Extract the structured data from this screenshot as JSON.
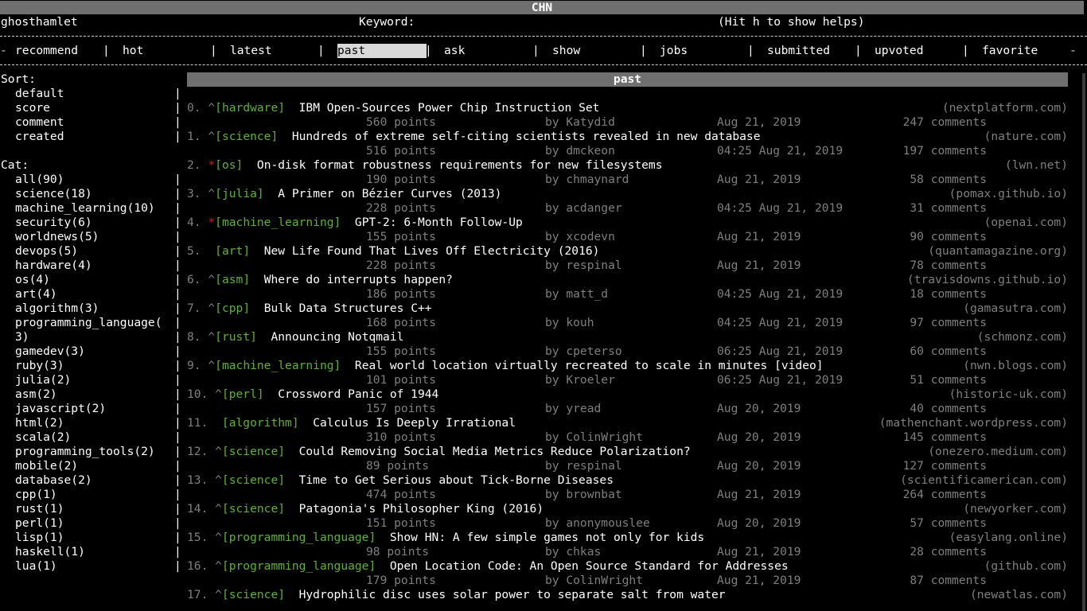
{
  "app": {
    "title": "CHN"
  },
  "header": {
    "user": "ghosthamlet",
    "keyword_label": "Keyword:",
    "help_hint": "(Hit h to show helps)"
  },
  "tabs": [
    {
      "label": "recommend"
    },
    {
      "label": "hot"
    },
    {
      "label": "latest"
    },
    {
      "label": "past",
      "selected": true
    },
    {
      "label": "ask"
    },
    {
      "label": "show"
    },
    {
      "label": "jobs"
    },
    {
      "label": "submitted"
    },
    {
      "label": "upvoted"
    },
    {
      "label": "favorite"
    }
  ],
  "sidebar": {
    "sort_label": "Sort:",
    "sort_items": [
      "default",
      "score",
      "comment",
      "created"
    ],
    "cat_label": "Cat:",
    "cat_items": [
      "all(90)",
      "science(18)",
      "machine_learning(10)",
      "security(6)",
      "worldnews(5)",
      "devops(5)",
      "hardware(4)",
      "os(4)",
      "art(4)",
      "algorithm(3)",
      "programming_language(",
      "3)",
      "gamedev(3)",
      "ruby(3)",
      "julia(2)",
      "asm(2)",
      "javascript(2)",
      "html(2)",
      "scala(2)",
      "programming_tools(2)",
      "mobile(2)",
      "database(2)",
      "cpp(1)",
      "rust(1)",
      "perl(1)",
      "lisp(1)",
      "haskell(1)",
      "lua(1)"
    ]
  },
  "main": {
    "section_title": "past",
    "stories": [
      {
        "n": "0.",
        "mark": "^",
        "cat": "[hardware]",
        "title": "IBM Open-Sources Power Chip Instruction Set",
        "site": "(nextplatform.com)",
        "points": "560 points",
        "by": "by Katydid",
        "date": "Aug 21, 2019",
        "comments": "247 comments"
      },
      {
        "n": "1.",
        "mark": "^",
        "cat": "[science]",
        "title": "Hundreds of extreme self-citing scientists revealed in new database",
        "site": "(nature.com)",
        "points": "516 points",
        "by": "by dmckeon",
        "date": "04:25 Aug 21, 2019",
        "comments": "197 comments"
      },
      {
        "n": "2.",
        "mark": "*",
        "cat": "[os]",
        "title": "On-disk format robustness requirements for new filesystems",
        "site": "(lwn.net)",
        "points": "190 points",
        "by": "by chmaynard",
        "date": "Aug 21, 2019",
        "comments": "58 comments"
      },
      {
        "n": "3.",
        "mark": "^",
        "cat": "[julia]",
        "title": "A Primer on Bézier Curves (2013)",
        "site": "(pomax.github.io)",
        "points": "228 points",
        "by": "by acdanger",
        "date": "04:25 Aug 21, 2019",
        "comments": "31 comments"
      },
      {
        "n": "4.",
        "mark": "*",
        "cat": "[machine_learning]",
        "title": "GPT-2: 6-Month Follow-Up",
        "site": "(openai.com)",
        "points": "155 points",
        "by": "by xcodevn",
        "date": "Aug 21, 2019",
        "comments": "90 comments"
      },
      {
        "n": "5.",
        "mark": "",
        "cat": "[art]",
        "title": "New Life Found That Lives Off Electricity (2016)",
        "site": "(quantamagazine.org)",
        "points": "228 points",
        "by": "by respinal",
        "date": "Aug 21, 2019",
        "comments": "78 comments"
      },
      {
        "n": "6.",
        "mark": "^",
        "cat": "[asm]",
        "title": "Where do interrupts happen?",
        "site": "(travisdowns.github.io)",
        "points": "186 points",
        "by": "by matt_d",
        "date": "04:25 Aug 21, 2019",
        "comments": "18 comments"
      },
      {
        "n": "7.",
        "mark": "^",
        "cat": "[cpp]",
        "title": "Bulk Data Structures C++",
        "site": "(gamasutra.com)",
        "points": "168 points",
        "by": "by kouh",
        "date": "04:25 Aug 21, 2019",
        "comments": "97 comments"
      },
      {
        "n": "8.",
        "mark": "^",
        "cat": "[rust]",
        "title": "Announcing Notqmail",
        "site": "(schmonz.com)",
        "points": "155 points",
        "by": "by cpeterso",
        "date": "06:25 Aug 21, 2019",
        "comments": "60 comments"
      },
      {
        "n": "9.",
        "mark": "^",
        "cat": "[machine_learning]",
        "title": "Real world location virtually recreated to scale in minutes [video]",
        "site": "(nwn.blogs.com)",
        "points": "101 points",
        "by": "by Kroeler",
        "date": "06:25 Aug 21, 2019",
        "comments": "51 comments"
      },
      {
        "n": "10.",
        "mark": "^",
        "cat": "[perl]",
        "title": "Crossword Panic of 1944",
        "site": "(historic-uk.com)",
        "points": "157 points",
        "by": "by yread",
        "date": "Aug 20, 2019",
        "comments": "40 comments"
      },
      {
        "n": "11.",
        "mark": "",
        "cat": "[algorithm]",
        "title": "Calculus Is Deeply Irrational",
        "site": "(mathenchant.wordpress.com)",
        "points": "310 points",
        "by": "by ColinWright",
        "date": "Aug 20, 2019",
        "comments": "145 comments"
      },
      {
        "n": "12.",
        "mark": "^",
        "cat": "[science]",
        "title": "Could Removing Social Media Metrics Reduce Polarization?",
        "site": "(onezero.medium.com)",
        "points": "89 points",
        "by": "by respinal",
        "date": "Aug 20, 2019",
        "comments": "127 comments"
      },
      {
        "n": "13.",
        "mark": "^",
        "cat": "[science]",
        "title": "Time to Get Serious about Tick-Borne Diseases",
        "site": "(scientificamerican.com)",
        "points": "474 points",
        "by": "by brownbat",
        "date": "Aug 21, 2019",
        "comments": "264 comments"
      },
      {
        "n": "14.",
        "mark": "^",
        "cat": "[science]",
        "title": "Patagonia's Philosopher King (2016)",
        "site": "(newyorker.com)",
        "points": "151 points",
        "by": "by anonymouslee",
        "date": "Aug 20, 2019",
        "comments": "57 comments"
      },
      {
        "n": "15.",
        "mark": "^",
        "cat": "[programming_language]",
        "title": "Show HN: A few simple games not only for kids",
        "site": "(easylang.online)",
        "points": "98 points",
        "by": "by chkas",
        "date": "Aug 21, 2019",
        "comments": "28 comments"
      },
      {
        "n": "16.",
        "mark": "^",
        "cat": "[programming_language]",
        "title": "Open Location Code: An Open Source Standard for Addresses",
        "site": "(github.com)",
        "points": "179 points",
        "by": "by ColinWright",
        "date": "Aug 21, 2019",
        "comments": "87 comments"
      },
      {
        "n": "17.",
        "mark": "^",
        "cat": "[science]",
        "title": "Hydrophilic disc uses solar power to separate salt from water",
        "site": "(newatlas.com)",
        "points": "",
        "by": "",
        "date": "",
        "comments": ""
      }
    ]
  },
  "colors": {
    "background": "#000000",
    "bar": "#6f6f6f",
    "category": "#5db32a",
    "star": "#d81b1b",
    "dim": "#7f7f7f"
  }
}
